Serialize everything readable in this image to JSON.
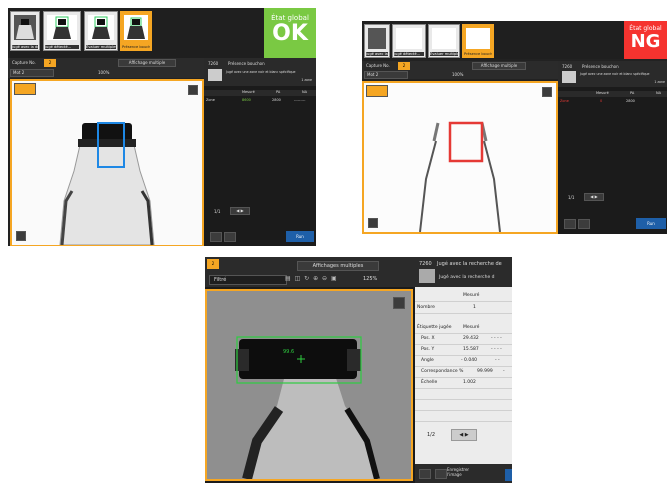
{
  "panel1": {
    "thumbnails": [
      {
        "caption": "Jugé avec la détection de l..."
      },
      {
        "caption": "Jugé détecté..."
      },
      {
        "caption": "Évaluer multiples"
      },
      {
        "caption": "Présence bouchon"
      }
    ],
    "status_label": "État global",
    "status_value": "OK",
    "status_color": "#7ac943",
    "capture_label": "Capture No.",
    "capture_num": "2",
    "multi_display": "Affichage multiple",
    "camera_select": "Mot 2",
    "zoom": "100%",
    "tool_num": "7260",
    "tool_name": "Présence bouchon",
    "tool_desc": "Jugé avec une zone noir et blanc spécifique",
    "tool_unit": "1 zone",
    "table_header": {
      "col1": "Mesuré",
      "col2": "PA",
      "col3": "NA"
    },
    "table_rows": [
      {
        "name": "Zone",
        "measured": "8600",
        "pa": "2800",
        "na": "---------"
      }
    ],
    "page": "1/1",
    "run_label": "Run"
  },
  "panel2": {
    "thumbnails": [
      {
        "caption": "Jugé avec la détection de l..."
      },
      {
        "caption": "Jugé détecté..."
      },
      {
        "caption": "Évaluer multiples"
      },
      {
        "caption": "Présence bouchon"
      }
    ],
    "status_label": "État global",
    "status_value": "NG",
    "status_color": "#f5332f",
    "capture_label": "Capture No.",
    "capture_num": "2",
    "multi_display": "Affichage multiple",
    "camera_select": "Mot 2",
    "zoom": "100%",
    "tool_num": "7260",
    "tool_name": "Présence bouchon",
    "tool_desc": "Jugé avec une zone noir et blanc spécifique",
    "tool_unit": "1 zone",
    "table_header": {
      "col1": "Mesuré",
      "col2": "PA",
      "col3": "NA"
    },
    "table_rows": [
      {
        "name": "Zone",
        "measured": "0",
        "pa": "2800",
        "na": ""
      }
    ],
    "page": "1/1",
    "run_label": "Run"
  },
  "panel3": {
    "tab_num": "2",
    "multi_display": "Affichages multiples",
    "filter_select": "Filtré",
    "zoom": "125%",
    "tool_num": "7260",
    "tool_title": "Jugé avec la recherche de",
    "tool_sub": "Jugé avec la recherche d",
    "value_overlay": "99.6",
    "header_measured": "Mesuré",
    "rows": [
      {
        "label": "Nombre",
        "value": "1",
        "extra": ""
      },
      {
        "label": "Étiquette jugée",
        "value": "Mesuré",
        "extra": ""
      },
      {
        "label": "Pos. X",
        "value": "29.432",
        "extra": "- - - -"
      },
      {
        "label": "Pos. Y",
        "value": "15.587",
        "extra": "- - - -"
      },
      {
        "label": "Angle",
        "value": "- 0.040",
        "extra": "- -"
      },
      {
        "label": "Correspondance %",
        "value": "99.999",
        "extra": "-"
      },
      {
        "label": "Échelle",
        "value": "1.002",
        "extra": ""
      }
    ],
    "page": "1/2",
    "save_image": "Enregistrer l'image"
  }
}
